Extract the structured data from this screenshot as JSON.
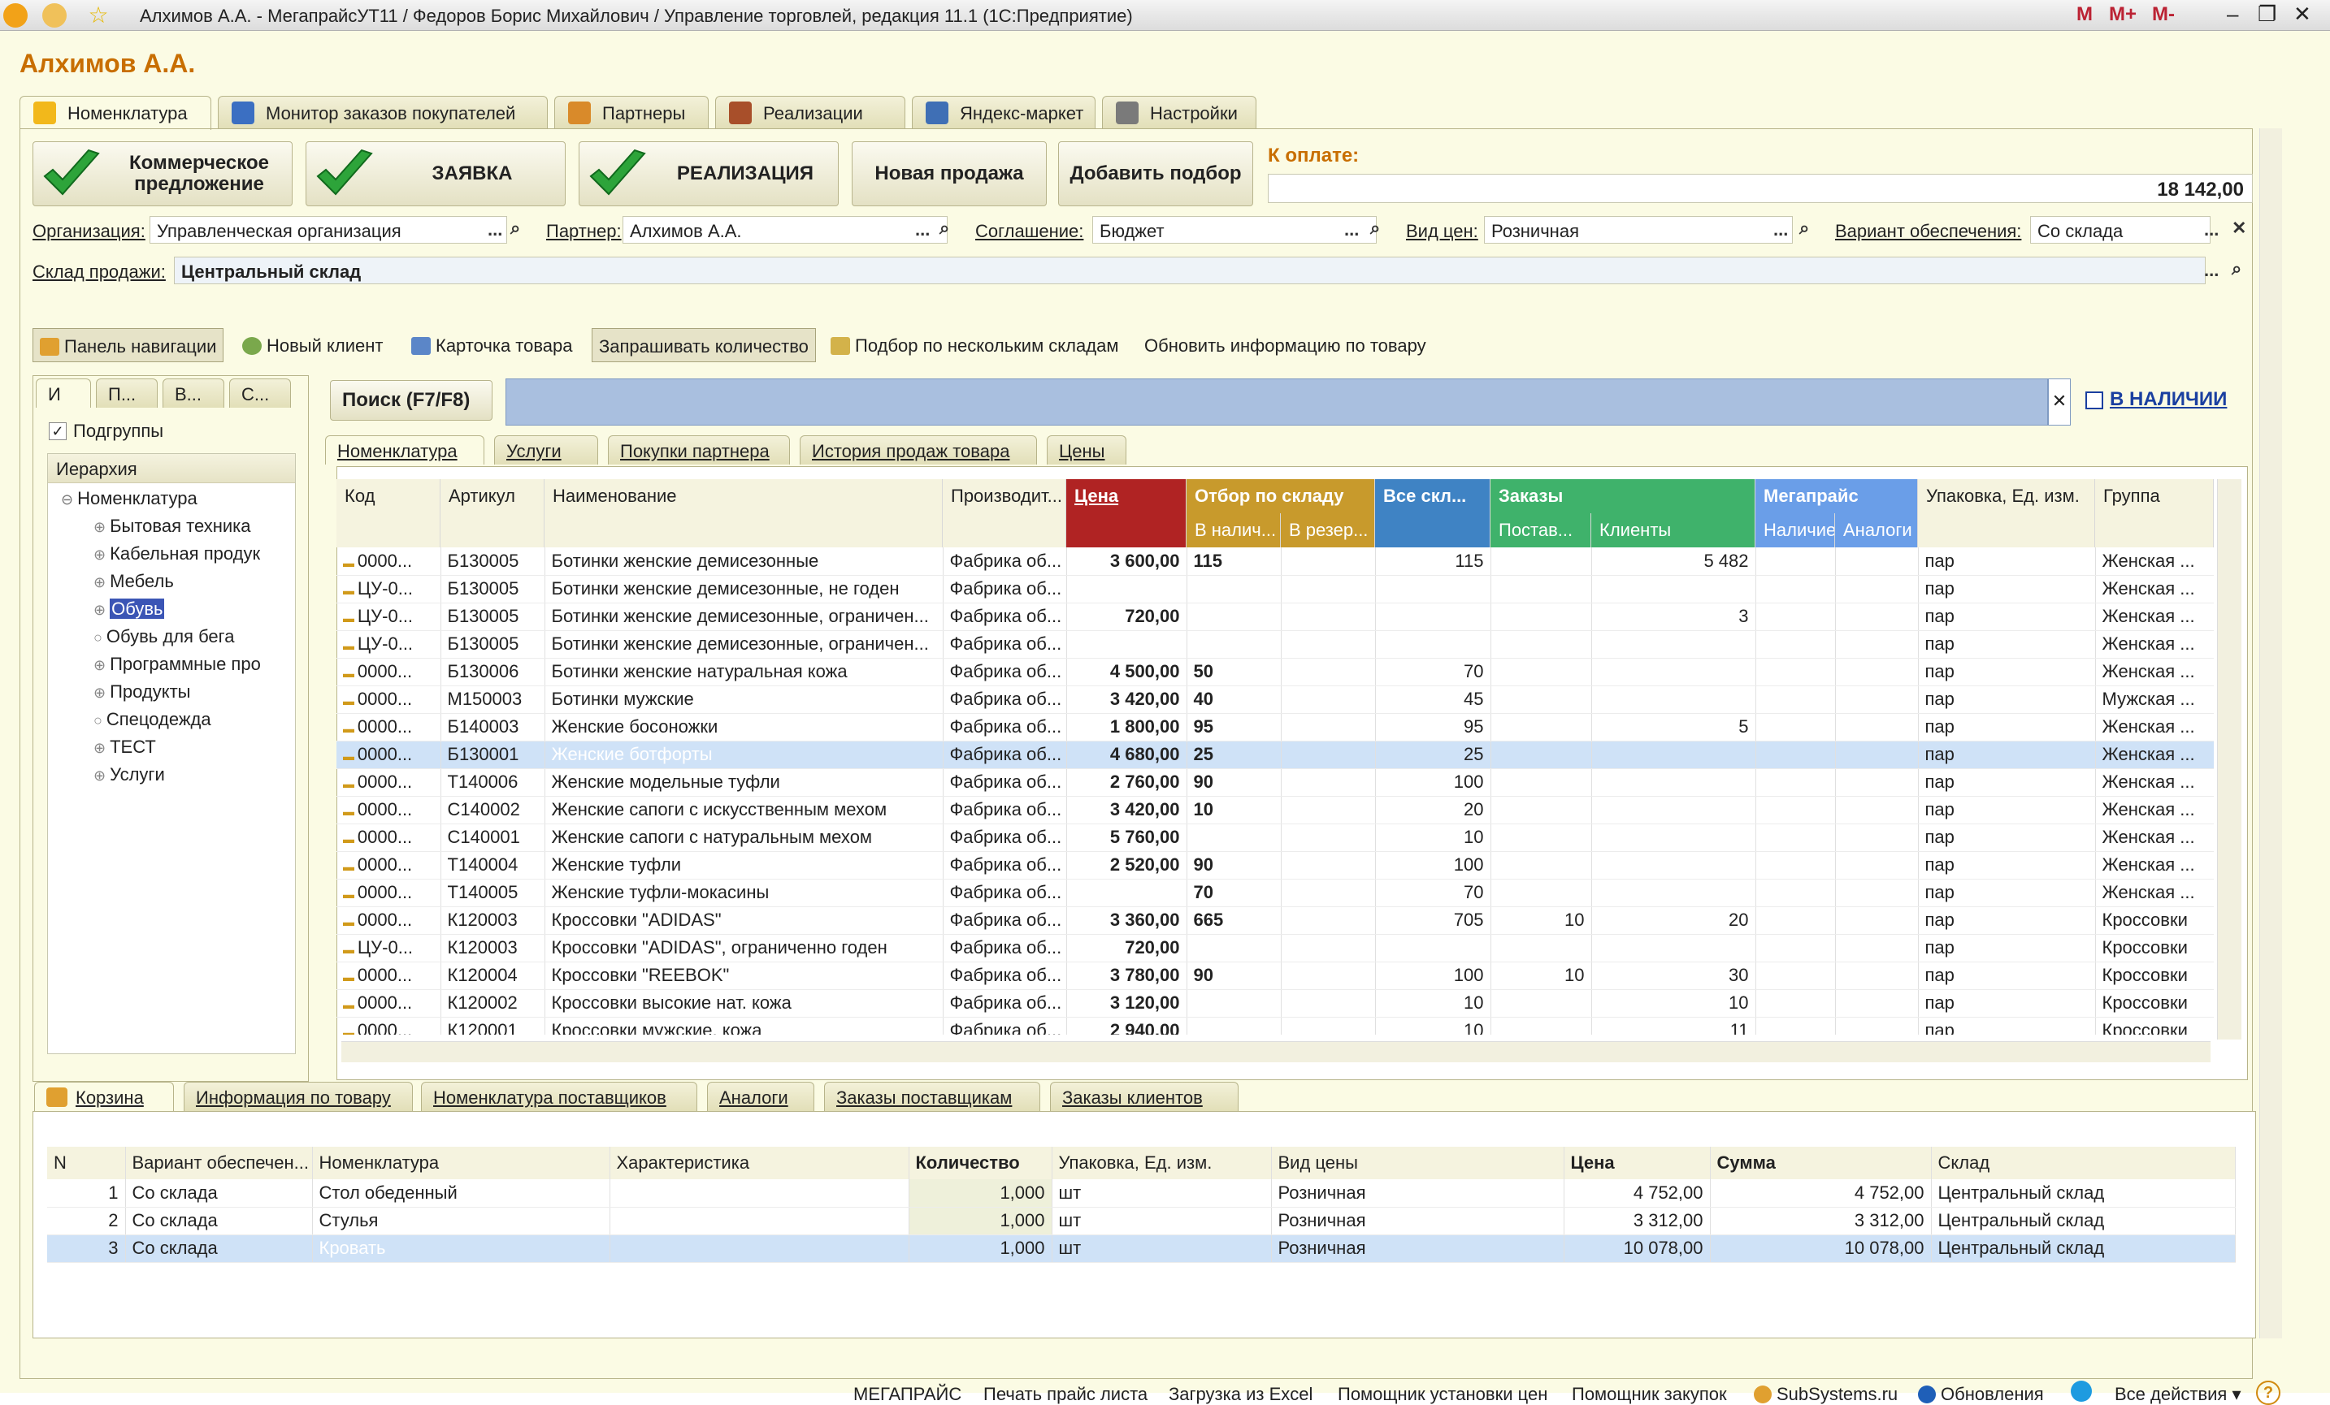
{
  "window": {
    "title": "Алхимов А.А. - МегапрайсУТ11 / Федоров Борис Михайлович / Управление торговлей, редакция 11.1 (1С:Предприятие)",
    "controls": [
      "M",
      "M+",
      "M-"
    ]
  },
  "page_title": "Алхимов А.А.",
  "main_tabs": [
    {
      "label": "Номенклатура",
      "icon": "catalog-icon",
      "active": true
    },
    {
      "label": "Монитор заказов покупателей",
      "icon": "monitor-icon"
    },
    {
      "label": "Партнеры",
      "icon": "partners-icon"
    },
    {
      "label": "Реализации",
      "icon": "sales-icon"
    },
    {
      "label": "Яндекс-маркет",
      "icon": "yandex-icon"
    },
    {
      "label": "Настройки",
      "icon": "settings-icon"
    }
  ],
  "actions": {
    "offer": "Коммерческое предложение",
    "request": "ЗАЯВКА",
    "realization": "РЕАЛИЗАЦИЯ",
    "new_sale": "Новая продажа",
    "add_selection": "Добавить подбор",
    "to_pay_label": "К оплате:",
    "to_pay_value": "18 142,00"
  },
  "fields": {
    "org_label": "Организация:",
    "org_value": "Управленческая организация",
    "partner_label": "Партнер:",
    "partner_value": "Алхимов А.А.",
    "agreement_label": "Соглашение:",
    "agreement_value": "Бюджет",
    "price_type_label": "Вид цен:",
    "price_type_value": "Розничная",
    "supply_label": "Вариант обеспечения:",
    "supply_value": "Со склада",
    "warehouse_label": "Склад продажи:",
    "warehouse_value": "Центральный склад",
    "ellipsis": "...",
    "clear": "✕"
  },
  "toolbar": {
    "nav_panel": "Панель навигации",
    "new_client": "Новый клиент",
    "item_card": "Карточка товара",
    "ask_qty": "Запрашивать количество",
    "multi_wh": "Подбор по нескольким складам",
    "refresh": "Обновить информацию по товару"
  },
  "left": {
    "tabs": [
      "И",
      "П...",
      "В...",
      "С..."
    ],
    "subgroups": "Подгруппы",
    "hierarchy": "Иерархия",
    "root": "Номенклатура",
    "items": [
      "Бытовая техника",
      "Кабельная продук",
      "Мебель",
      "Обувь",
      "Обувь для бега",
      "Программные про",
      "Продукты",
      "Спецодежда",
      "ТЕСТ",
      "Услуги"
    ],
    "selected": "Обувь"
  },
  "search": {
    "label": "Поиск (F7/F8)",
    "value": "",
    "in_stock": "В НАЛИЧИИ"
  },
  "sub_tabs": [
    "Номенклатура",
    "Услуги",
    "Покупки партнера",
    "История продаж товара",
    "Цены"
  ],
  "grid_head": {
    "code": "Код",
    "article": "Артикул",
    "name": "Наименование",
    "maker": "Производит...",
    "price": "Цена",
    "wh": "Отбор по складу",
    "wh_avail": "В налич...",
    "wh_res": "В резер...",
    "allwh": "Все скл...",
    "orders": "Заказы",
    "ord_sup": "Постав...",
    "ord_cli": "Клиенты",
    "mega": "Мегапрайс",
    "mega_avail": "Наличие",
    "mega_analog": "Аналоги",
    "pack": "Упаковка, Ед. изм.",
    "group": "Группа"
  },
  "grid_colors": {
    "price": "#b02323",
    "wh": "#c89a2c",
    "allwh": "#3f83c4",
    "orders": "#3fb26b",
    "mega": "#6a9ee8"
  },
  "grid_rows": [
    {
      "code": "0000...",
      "art": "Б130005",
      "name": "Ботинки женские демисезонные",
      "maker": "Фабрика об...",
      "price": "3 600,00",
      "avail": "115",
      "res": "",
      "all": "115",
      "sup": "",
      "cli": "5 482",
      "ma": "",
      "man": "",
      "pack": "пар",
      "group": "Женская ..."
    },
    {
      "code": "ЦУ-0...",
      "art": "Б130005",
      "name": "Ботинки женские демисезонные, не годен",
      "maker": "Фабрика об...",
      "price": "",
      "avail": "",
      "res": "",
      "all": "",
      "sup": "",
      "cli": "",
      "ma": "",
      "man": "",
      "pack": "пар",
      "group": "Женская ..."
    },
    {
      "code": "ЦУ-0...",
      "art": "Б130005",
      "name": "Ботинки женские демисезонные, ограничен...",
      "maker": "Фабрика об...",
      "price": "720,00",
      "avail": "",
      "res": "",
      "all": "",
      "sup": "",
      "cli": "3",
      "ma": "",
      "man": "",
      "pack": "пар",
      "group": "Женская ..."
    },
    {
      "code": "ЦУ-0...",
      "art": "Б130005",
      "name": "Ботинки женские демисезонные, ограничен...",
      "maker": "Фабрика об...",
      "price": "",
      "avail": "",
      "res": "",
      "all": "",
      "sup": "",
      "cli": "",
      "ma": "",
      "man": "",
      "pack": "пар",
      "group": "Женская ..."
    },
    {
      "code": "0000...",
      "art": "Б130006",
      "name": "Ботинки женские натуральная кожа",
      "maker": "Фабрика об...",
      "price": "4 500,00",
      "avail": "50",
      "res": "",
      "all": "70",
      "sup": "",
      "cli": "",
      "ma": "",
      "man": "",
      "pack": "пар",
      "group": "Женская ..."
    },
    {
      "code": "0000...",
      "art": "М150003",
      "name": "Ботинки мужские",
      "maker": "Фабрика об...",
      "price": "3 420,00",
      "avail": "40",
      "res": "",
      "all": "45",
      "sup": "",
      "cli": "",
      "ma": "",
      "man": "",
      "pack": "пар",
      "group": "Мужская ..."
    },
    {
      "code": "0000...",
      "art": "Б140003",
      "name": "Женские босоножки",
      "maker": "Фабрика об...",
      "price": "1 800,00",
      "avail": "95",
      "res": "",
      "all": "95",
      "sup": "",
      "cli": "5",
      "ma": "",
      "man": "",
      "pack": "пар",
      "group": "Женская ..."
    },
    {
      "code": "0000...",
      "art": "Б130001",
      "name": "Женские ботфорты",
      "maker": "Фабрика об...",
      "price": "4 680,00",
      "avail": "25",
      "res": "",
      "all": "25",
      "sup": "",
      "cli": "",
      "ma": "",
      "man": "",
      "pack": "пар",
      "group": "Женская ...",
      "sel": true
    },
    {
      "code": "0000...",
      "art": "Т140006",
      "name": "Женские модельные туфли",
      "maker": "Фабрика об...",
      "price": "2 760,00",
      "avail": "90",
      "res": "",
      "all": "100",
      "sup": "",
      "cli": "",
      "ma": "",
      "man": "",
      "pack": "пар",
      "group": "Женская ..."
    },
    {
      "code": "0000...",
      "art": "С140002",
      "name": "Женские сапоги с искусственным мехом",
      "maker": "Фабрика об...",
      "price": "3 420,00",
      "avail": "10",
      "res": "",
      "all": "20",
      "sup": "",
      "cli": "",
      "ma": "",
      "man": "",
      "pack": "пар",
      "group": "Женская ..."
    },
    {
      "code": "0000...",
      "art": "С140001",
      "name": "Женские сапоги с натуральным мехом",
      "maker": "Фабрика об...",
      "price": "5 760,00",
      "avail": "",
      "res": "",
      "all": "10",
      "sup": "",
      "cli": "",
      "ma": "",
      "man": "",
      "pack": "пар",
      "group": "Женская ..."
    },
    {
      "code": "0000...",
      "art": "Т140004",
      "name": "Женские туфли",
      "maker": "Фабрика об...",
      "price": "2 520,00",
      "avail": "90",
      "res": "",
      "all": "100",
      "sup": "",
      "cli": "",
      "ma": "",
      "man": "",
      "pack": "пар",
      "group": "Женская ..."
    },
    {
      "code": "0000...",
      "art": "Т140005",
      "name": "Женские туфли-мокасины",
      "maker": "Фабрика об...",
      "price": "",
      "avail": "70",
      "res": "",
      "all": "70",
      "sup": "",
      "cli": "",
      "ma": "",
      "man": "",
      "pack": "пар",
      "group": "Женская ..."
    },
    {
      "code": "0000...",
      "art": "К120003",
      "name": "Кроссовки \"ADIDAS\"",
      "maker": "Фабрика об...",
      "price": "3 360,00",
      "avail": "665",
      "res": "",
      "all": "705",
      "sup": "10",
      "cli": "20",
      "ma": "",
      "man": "",
      "pack": "пар",
      "group": "Кроссовки"
    },
    {
      "code": "ЦУ-0...",
      "art": "К120003",
      "name": "Кроссовки \"ADIDAS\", ограниченно годен",
      "maker": "Фабрика об...",
      "price": "720,00",
      "avail": "",
      "res": "",
      "all": "",
      "sup": "",
      "cli": "",
      "ma": "",
      "man": "",
      "pack": "пар",
      "group": "Кроссовки"
    },
    {
      "code": "0000...",
      "art": "К120004",
      "name": "Кроссовки \"REEBOK\"",
      "maker": "Фабрика об...",
      "price": "3 780,00",
      "avail": "90",
      "res": "",
      "all": "100",
      "sup": "10",
      "cli": "30",
      "ma": "",
      "man": "",
      "pack": "пар",
      "group": "Кроссовки"
    },
    {
      "code": "0000...",
      "art": "К120002",
      "name": "Кроссовки высокие нат. кожа",
      "maker": "Фабрика об...",
      "price": "3 120,00",
      "avail": "",
      "res": "",
      "all": "10",
      "sup": "",
      "cli": "10",
      "ma": "",
      "man": "",
      "pack": "пар",
      "group": "Кроссовки"
    },
    {
      "code": "0000...",
      "art": "К120001",
      "name": "Кроссовки мужские, кожа",
      "maker": "Фабрика об...",
      "price": "2 940,00",
      "avail": "",
      "res": "",
      "all": "10",
      "sup": "",
      "cli": "11",
      "ma": "",
      "man": "",
      "pack": "пар",
      "group": "Кроссовки"
    }
  ],
  "bottom_tabs": [
    "Корзина",
    "Информация по товару",
    "Номенклатура поставщиков",
    "Аналоги",
    "Заказы поставщикам",
    "Заказы клиентов"
  ],
  "cart_head": [
    "N",
    "Вариант обеспечен...",
    "Номенклатура",
    "Характеристика",
    "Количество",
    "Упаковка, Ед. изм.",
    "Вид цены",
    "Цена",
    "Сумма",
    "Склад"
  ],
  "cart_rows": [
    {
      "n": "1",
      "supply": "Со склада",
      "item": "Стол обеденный",
      "char": "",
      "qty": "1,000",
      "unit": "шт",
      "ptype": "Розничная",
      "price": "4 752,00",
      "sum": "4 752,00",
      "wh": "Центральный склад"
    },
    {
      "n": "2",
      "supply": "Со склада",
      "item": "Стулья",
      "char": "",
      "qty": "1,000",
      "unit": "шт",
      "ptype": "Розничная",
      "price": "3 312,00",
      "sum": "3 312,00",
      "wh": "Центральный склад"
    },
    {
      "n": "3",
      "supply": "Со склада",
      "item": "Кровать",
      "char": "",
      "qty": "1,000",
      "unit": "шт",
      "ptype": "Розничная",
      "price": "10 078,00",
      "sum": "10 078,00",
      "wh": "Центральный склад",
      "sel": true
    }
  ],
  "footer": [
    "МЕГАПРАЙС",
    "Печать прайс листа",
    "Загрузка из Excel",
    "Помощник установки цен",
    "Помощник закупок",
    "SubSystems.ru",
    "Обновления",
    "Все действия ▾"
  ]
}
